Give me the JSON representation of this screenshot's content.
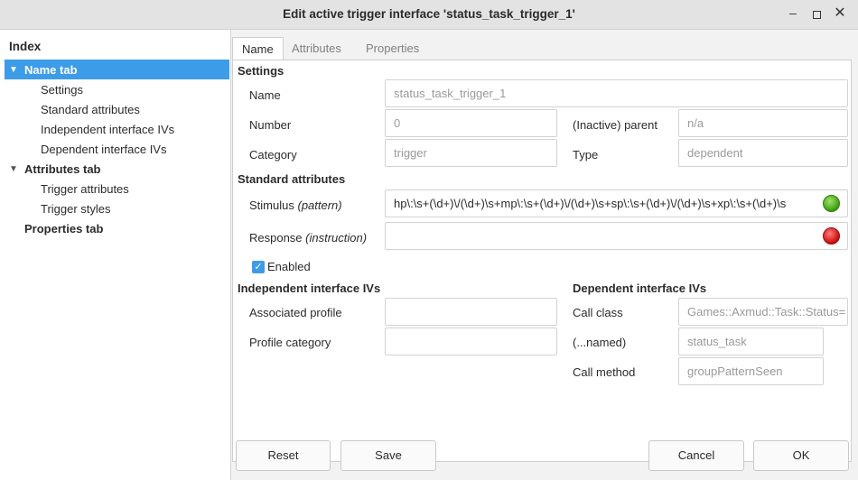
{
  "window": {
    "title": "Edit active trigger interface 'status_task_trigger_1'",
    "minimize_glyph": "–",
    "close_glyph": "✕"
  },
  "sidebar": {
    "header": "Index",
    "items": [
      {
        "label": "Name tab",
        "level": 0,
        "expanded": true,
        "selected": true
      },
      {
        "label": "Settings",
        "level": 1
      },
      {
        "label": "Standard attributes",
        "level": 1
      },
      {
        "label": "Independent interface IVs",
        "level": 1
      },
      {
        "label": "Dependent interface IVs",
        "level": 1
      },
      {
        "label": "Attributes tab",
        "level": 0,
        "expanded": true
      },
      {
        "label": "Trigger attributes",
        "level": 1
      },
      {
        "label": "Trigger styles",
        "level": 1
      },
      {
        "label": "Properties tab",
        "level": 0,
        "expanded": false
      }
    ]
  },
  "tabs": [
    {
      "label": "Name",
      "active": true
    },
    {
      "label": "Attributes",
      "active": false
    },
    {
      "label": "Properties",
      "active": false
    }
  ],
  "settings": {
    "heading": "Settings",
    "name_label": "Name",
    "name_value": "status_task_trigger_1",
    "number_label": "Number",
    "number_value": "0",
    "parent_label": "(Inactive) parent",
    "parent_value": "n/a",
    "category_label": "Category",
    "category_value": "trigger",
    "type_label": "Type",
    "type_value": "dependent"
  },
  "standard": {
    "heading": "Standard attributes",
    "stimulus_label": "Stimulus",
    "stimulus_hint": "(pattern)",
    "stimulus_value": "hp\\:\\s+(\\d+)\\/(\\d+)\\s+mp\\:\\s+(\\d+)\\/(\\d+)\\s+sp\\:\\s+(\\d+)\\/(\\d+)\\s+xp\\:\\s+(\\d+)\\s",
    "stimulus_status_color": "#3c9d12",
    "response_label": "Response",
    "response_hint": "(instruction)",
    "response_value": "",
    "response_status_color": "#c80d0d",
    "enabled_label": "Enabled",
    "enabled_checked": true
  },
  "independent": {
    "heading": "Independent interface IVs",
    "profile_label": "Associated profile",
    "profile_value": "",
    "category_label": "Profile category",
    "category_value": ""
  },
  "dependent": {
    "heading": "Dependent interface IVs",
    "call_class_label": "Call class",
    "call_class_value": "Games::Axmud::Task::Status=",
    "named_label": "(...named)",
    "named_value": "status_task",
    "method_label": "Call method",
    "method_value": "groupPatternSeen"
  },
  "buttons": {
    "reset": "Reset",
    "save": "Save",
    "cancel": "Cancel",
    "ok": "OK"
  },
  "colors": {
    "selection": "#3d9ce8"
  }
}
